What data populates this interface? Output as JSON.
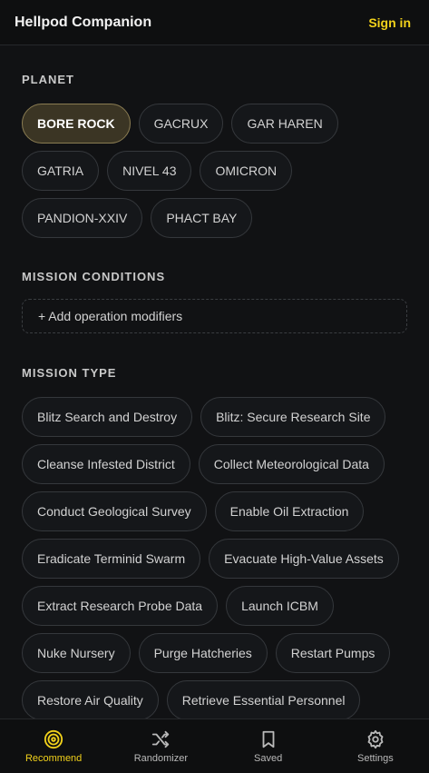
{
  "header": {
    "title": "Hellpod Companion",
    "sign_in": "Sign in"
  },
  "planet": {
    "title": "PLANET",
    "selected": "BORE ROCK",
    "options": [
      "BORE ROCK",
      "GACRUX",
      "GAR HAREN",
      "GATRIA",
      "NIVEL 43",
      "OMICRON",
      "PANDION-XXIV",
      "PHACT BAY"
    ]
  },
  "mission_conditions": {
    "title": "MISSION CONDITIONS",
    "add_label": "+ Add operation modifiers"
  },
  "mission_type": {
    "title": "MISSION TYPE",
    "options": [
      "Blitz Search and Destroy",
      "Blitz: Secure Research Site",
      "Cleanse Infested District",
      "Collect Meteorological Data",
      "Conduct Geological Survey",
      "Enable Oil Extraction",
      "Eradicate Terminid Swarm",
      "Evacuate High-Value Assets",
      "Extract Research Probe Data",
      "Launch ICBM",
      "Nuke Nursery",
      "Purge Hatcheries",
      "Restart Pumps",
      "Restore Air Quality",
      "Retrieve Essential Personnel"
    ]
  },
  "nav": {
    "items": [
      {
        "label": "Recommend",
        "icon": "target-icon",
        "active": true
      },
      {
        "label": "Randomizer",
        "icon": "shuffle-icon",
        "active": false
      },
      {
        "label": "Saved",
        "icon": "bookmark-icon",
        "active": false
      },
      {
        "label": "Settings",
        "icon": "gear-icon",
        "active": false
      }
    ]
  },
  "colors": {
    "accent": "#f2d21b",
    "background": "#111214",
    "selected_chip": "#3b3524"
  }
}
